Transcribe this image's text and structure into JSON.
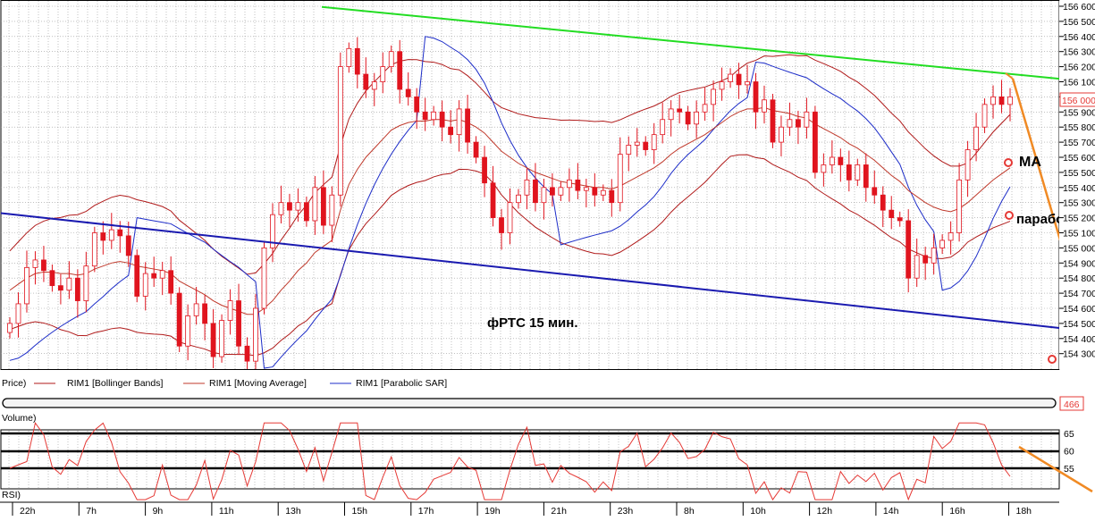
{
  "colors": {
    "background": "#ffffff",
    "grid": "#9a9a9a",
    "candle_bear": "#e0141e",
    "candle_bull_fill": "#ffffff",
    "bollinger": "#b01a1a",
    "moving_average": "#c0392b",
    "parabolic_sar": "#1c2cc8",
    "trend_upper": "#22dd22",
    "trend_lower": "#1a1ab0",
    "forecast": "#f08a24",
    "rsi_line": "#e53935",
    "current_price_box": "#e53935"
  },
  "icons": {
    "volume_end": "scrollbar-end-icon"
  },
  "legend": {
    "price": "Price)",
    "bollinger": "RIM1 [Bollinger Bands]",
    "ma": "RIM1 [Moving Average]",
    "sar": "RIM1 [Parabolic SAR]"
  },
  "volume": {
    "label": "Volume)",
    "value": "466"
  },
  "rsi": {
    "label": "RSI)"
  },
  "annotations": {
    "title": "фРТС   15 мин.",
    "ma": "МА",
    "parabolic": "параболик"
  },
  "current_price": "156 000",
  "chart_data": {
    "type": "candlestick",
    "y_axis": {
      "ylim": [
        154250,
        156620
      ],
      "ticks": [
        "156 600",
        "156 500",
        "156 400",
        "156 300",
        "156 200",
        "156 100",
        "156 000",
        "155 900",
        "155 800",
        "155 700",
        "155 600",
        "155 500",
        "155 400",
        "155 300",
        "155 200",
        "155 100",
        "155 000",
        "154 900",
        "154 800",
        "154 700",
        "154 600",
        "154 500",
        "154 400",
        "154 300"
      ]
    },
    "x_axis": {
      "ticks": [
        "22h",
        "7h",
        "9h",
        "11h",
        "13h",
        "15h",
        "17h",
        "19h",
        "21h",
        "23h",
        "8h",
        "10h",
        "12h",
        "14h",
        "16h",
        "18h"
      ]
    },
    "candles_close": [
      154500,
      154630,
      154870,
      154920,
      154850,
      154750,
      154720,
      154800,
      154650,
      154880,
      155100,
      155050,
      155120,
      155080,
      154950,
      154680,
      154830,
      154800,
      154850,
      154700,
      154350,
      154550,
      154630,
      154500,
      154280,
      154520,
      154650,
      154350,
      154250,
      154600,
      155000,
      155220,
      155300,
      155250,
      155300,
      155180,
      155400,
      155150,
      155350,
      156200,
      156320,
      156150,
      156050,
      156100,
      156200,
      156300,
      156050,
      156000,
      155900,
      155850,
      155900,
      155800,
      155750,
      155920,
      155700,
      155600,
      155430,
      155200,
      155100,
      155300,
      155350,
      155450,
      155300,
      155400,
      155350,
      155400,
      155450,
      155380,
      155400,
      155350,
      155380,
      155300,
      155620,
      155680,
      155700,
      155650,
      155750,
      155850,
      155920,
      155900,
      155820,
      155900,
      155950,
      156050,
      156100,
      156150,
      156080,
      156100,
      155900,
      155980,
      155700,
      155800,
      155850,
      155800,
      155900,
      155500,
      155550,
      155600,
      155550,
      155450,
      155550,
      155400,
      155350,
      155250,
      155200,
      155180,
      154800,
      154950,
      154900,
      155000,
      155050,
      155100,
      155450,
      155650,
      155800,
      155950,
      156000,
      155950,
      156000
    ],
    "moving_average": {
      "name": "RIM1 [Moving Average]",
      "values": [
        154720,
        154760,
        154800,
        154830,
        154840,
        154840,
        154830,
        154830,
        154820,
        154830,
        154860,
        154880,
        154900,
        154910,
        154900,
        154880,
        154870,
        154860,
        154850,
        154830,
        154780,
        154750,
        154720,
        154690,
        154650,
        154620,
        154600,
        154580,
        154560,
        154560,
        154600,
        154650,
        154720,
        154780,
        154850,
        154900,
        154970,
        155010,
        155050,
        155250,
        155420,
        155520,
        155600,
        155660,
        155720,
        155780,
        155810,
        155830,
        155840,
        155840,
        155850,
        155850,
        155840,
        155850,
        155830,
        155800,
        155760,
        155700,
        155640,
        155600,
        155560,
        155530,
        155500,
        155480,
        155460,
        155440,
        155430,
        155420,
        155410,
        155400,
        155400,
        155390,
        155410,
        155440,
        155470,
        155500,
        155530,
        155570,
        155620,
        155660,
        155690,
        155720,
        155750,
        155790,
        155830,
        155870,
        155900,
        155920,
        155920,
        155930,
        155910,
        155900,
        155890,
        155870,
        155860,
        155820,
        155790,
        155760,
        155730,
        155690,
        155660,
        155620,
        155580,
        155530,
        155480,
        155440,
        155380,
        155340,
        155300,
        155270,
        155250,
        155240,
        155260,
        155300,
        155350,
        155400,
        155450,
        155490,
        155530
      ]
    },
    "bollinger_bands": {
      "name": "RIM1 [Bollinger Bands]"
    },
    "parabolic_sar": {
      "name": "RIM1 [Parabolic SAR]"
    },
    "trendlines": [
      {
        "from": [
          "19h",
          "156560"
        ],
        "to": [
          "18h",
          "156120"
        ]
      },
      {
        "from": [
          "22h",
          "155230"
        ],
        "to": [
          "18h",
          "154470"
        ]
      }
    ],
    "rsi": {
      "ylim": [
        45,
        70
      ],
      "ticks": [
        "65",
        "60",
        "55"
      ]
    }
  }
}
